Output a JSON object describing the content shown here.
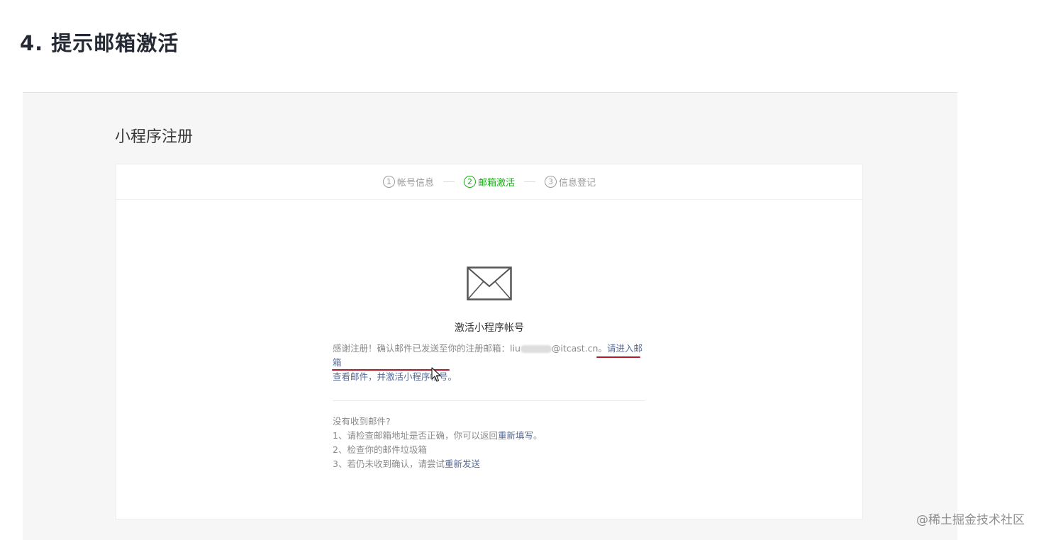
{
  "article": {
    "heading": "4. 提示邮箱激活"
  },
  "page": {
    "title": "小程序注册"
  },
  "stepper": {
    "steps": [
      {
        "num": "1",
        "label": "帐号信息",
        "active": false
      },
      {
        "num": "2",
        "label": "邮箱激活",
        "active": true
      },
      {
        "num": "3",
        "label": "信息登记",
        "active": false
      }
    ]
  },
  "icons": {
    "mail": "mail-envelope-icon"
  },
  "activation": {
    "title": "激活小程序帐号",
    "message_prefix": "感谢注册！确认邮件已发送至你的注册邮箱：liu",
    "message_email_domain": "@itcast.cn。",
    "message_link_line1": "请进入邮箱",
    "message_link_line2": "查看邮件，并激活小程序帐号。"
  },
  "help": {
    "heading": "没有收到邮件?",
    "item1_text": "1、请检查邮箱地址是否正确，你可以返回",
    "item1_link": "重新填写",
    "item1_end": "。",
    "item2_text": "2、检查你的邮件垃圾箱",
    "item3_text": "3、若仍未收到确认，请尝试",
    "item3_link": "重新发送"
  },
  "watermark": "@稀土掘金技术社区",
  "colors": {
    "accent_green": "#1aad19",
    "link_blue": "#576b95",
    "annotation_red": "#b1182a"
  }
}
